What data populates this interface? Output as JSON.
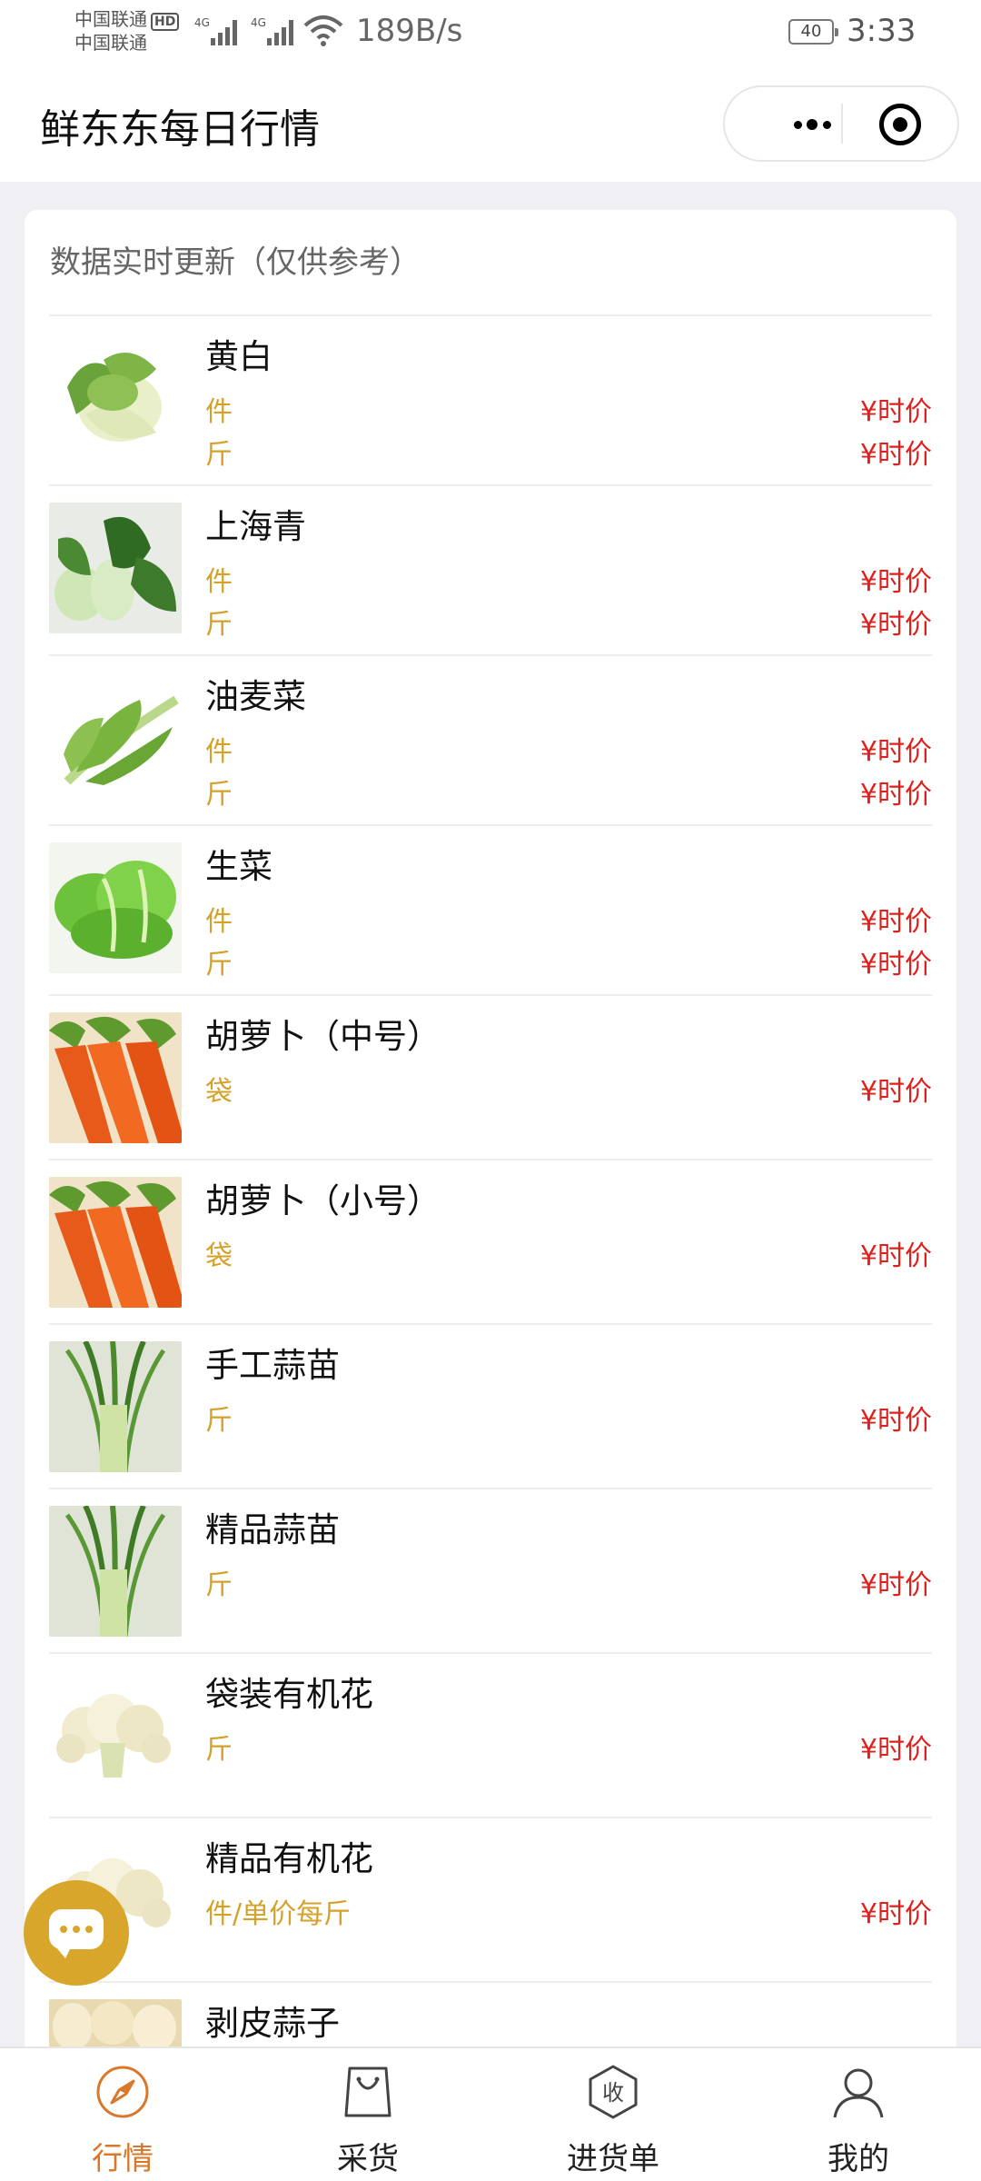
{
  "status_bar": {
    "carrier_1": "中国联通",
    "carrier_1_badge": "HD",
    "carrier_2": "中国联通",
    "signal_1": "4G",
    "signal_2": "4G",
    "net_speed": "189B/s",
    "battery": "40",
    "time": "3:33"
  },
  "title_bar": {
    "title": "鲜东东每日行情"
  },
  "card": {
    "header": "数据实时更新（仅供参考）",
    "items": [
      {
        "name": "黄白",
        "units": [
          {
            "unit": "件",
            "price": "¥时价"
          },
          {
            "unit": "斤",
            "price": "¥时价"
          }
        ]
      },
      {
        "name": "上海青",
        "units": [
          {
            "unit": "件",
            "price": "¥时价"
          },
          {
            "unit": "斤",
            "price": "¥时价"
          }
        ]
      },
      {
        "name": "油麦菜",
        "units": [
          {
            "unit": "件",
            "price": "¥时价"
          },
          {
            "unit": "斤",
            "price": "¥时价"
          }
        ]
      },
      {
        "name": "生菜",
        "units": [
          {
            "unit": "件",
            "price": "¥时价"
          },
          {
            "unit": "斤",
            "price": "¥时价"
          }
        ]
      },
      {
        "name": "胡萝卜（中号）",
        "units": [
          {
            "unit": "袋",
            "price": "¥时价"
          }
        ]
      },
      {
        "name": "胡萝卜（小号）",
        "units": [
          {
            "unit": "袋",
            "price": "¥时价"
          }
        ]
      },
      {
        "name": "手工蒜苗",
        "units": [
          {
            "unit": "斤",
            "price": "¥时价"
          }
        ]
      },
      {
        "name": "精品蒜苗",
        "units": [
          {
            "unit": "斤",
            "price": "¥时价"
          }
        ]
      },
      {
        "name": "袋装有机花",
        "units": [
          {
            "unit": "斤",
            "price": "¥时价"
          }
        ]
      },
      {
        "name": "精品有机花",
        "units": [
          {
            "unit": "件/单价每斤",
            "price": "¥时价"
          }
        ]
      },
      {
        "name": "剥皮蒜子",
        "units": []
      }
    ]
  },
  "tab_bar": {
    "tabs": [
      {
        "label": "行情",
        "icon": "compass-icon",
        "active": true
      },
      {
        "label": "采货",
        "icon": "shopping-bag-icon",
        "active": false
      },
      {
        "label": "进货单",
        "icon": "receipt-hexagon-icon",
        "active": false
      },
      {
        "label": "我的",
        "icon": "user-icon",
        "active": false
      }
    ],
    "accent_color": "#d9772a"
  },
  "colors": {
    "unit": "#d4a12a",
    "price": "#e0201c",
    "chat_button": "#d9a62c"
  }
}
